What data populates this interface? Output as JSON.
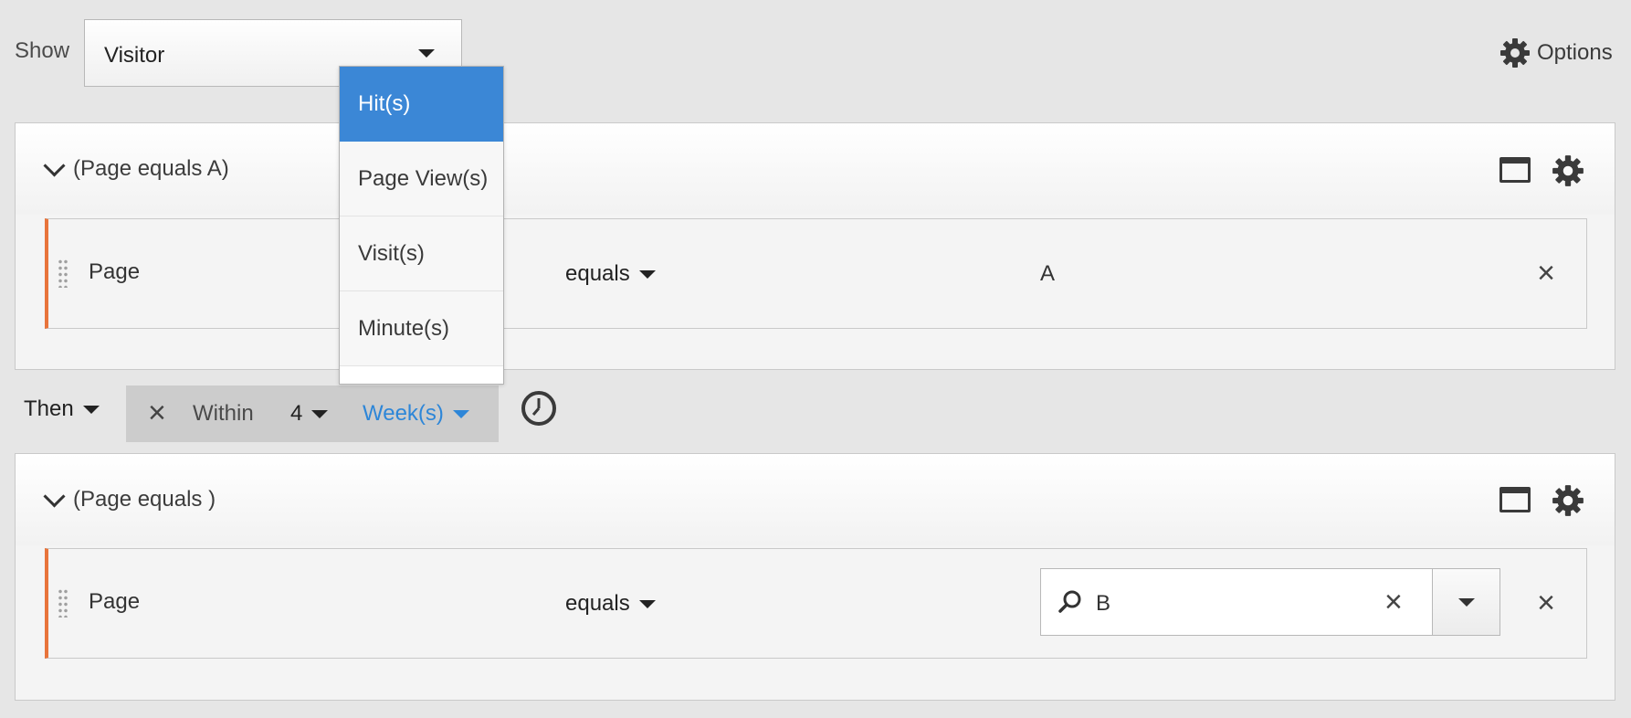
{
  "header": {
    "show_label": "Show",
    "show_value": "Visitor",
    "options_label": "Options"
  },
  "container1": {
    "title": "(Page equals A)",
    "rule": {
      "field": "Page",
      "operator": "equals",
      "value": "A"
    }
  },
  "sequence": {
    "then_label": "Then",
    "within_label": "Within",
    "within_count": "4",
    "within_unit": "Week(s)",
    "unit_options": [
      "Hit(s)",
      "Page View(s)",
      "Visit(s)",
      "Minute(s)"
    ],
    "selected_option": "Hit(s)"
  },
  "container2": {
    "title": "(Page equals )",
    "rule": {
      "field": "Page",
      "operator": "equals",
      "search_value": "B"
    }
  },
  "colors": {
    "accent": "#3b87d6",
    "link": "#2d86d8",
    "rule_marker": "#e8743b",
    "background": "#e6e6e6"
  },
  "icons": [
    "caret-down-icon",
    "gear-icon",
    "chevron-down-icon",
    "window-icon",
    "drag-handle-icon",
    "close-icon",
    "clock-icon",
    "search-icon"
  ]
}
